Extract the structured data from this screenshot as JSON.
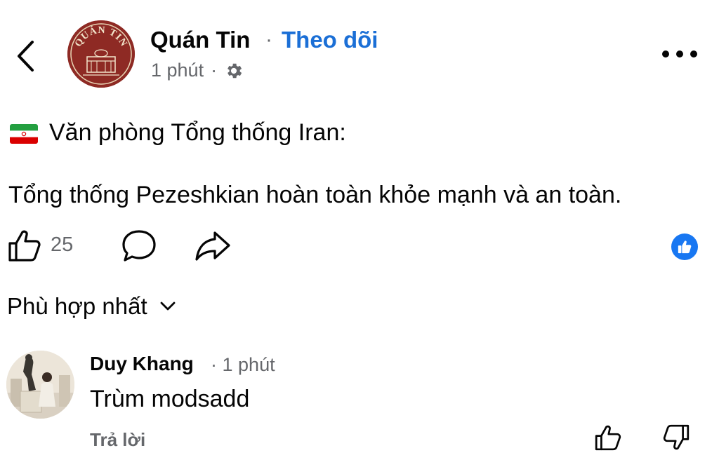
{
  "post": {
    "page_name": "Quán Tin",
    "separator": "·",
    "follow_label": "Theo dõi",
    "time": "1 phút",
    "time_separator": "·",
    "logo_text": "QUÁN TIN",
    "line1": "Văn phòng Tổng thống Iran:",
    "line2": "Tổng thống Pezeshkian hoàn toàn khỏe mạnh và an toàn.",
    "like_count": "25",
    "icons": {
      "back": "chevron-left-icon",
      "privacy": "gear-icon",
      "more": "more-horizontal-icon",
      "flag": "iran-flag-icon",
      "like": "thumbs-up-icon",
      "comment": "comment-bubble-icon",
      "share": "share-arrow-icon",
      "reaction": "like-reaction-icon"
    }
  },
  "comments_section": {
    "sort_label": "Phù hợp nhất",
    "comments": [
      {
        "author": "Duy Khang",
        "separator": "·",
        "time": "1 phút",
        "text": "Trùm modsadd",
        "reply_label": "Trả lời"
      }
    ]
  },
  "colors": {
    "accent": "#1b6fd6",
    "reaction_blue": "#1877f2",
    "secondary_text": "#65676b",
    "logo_bg": "#8e2a24"
  }
}
